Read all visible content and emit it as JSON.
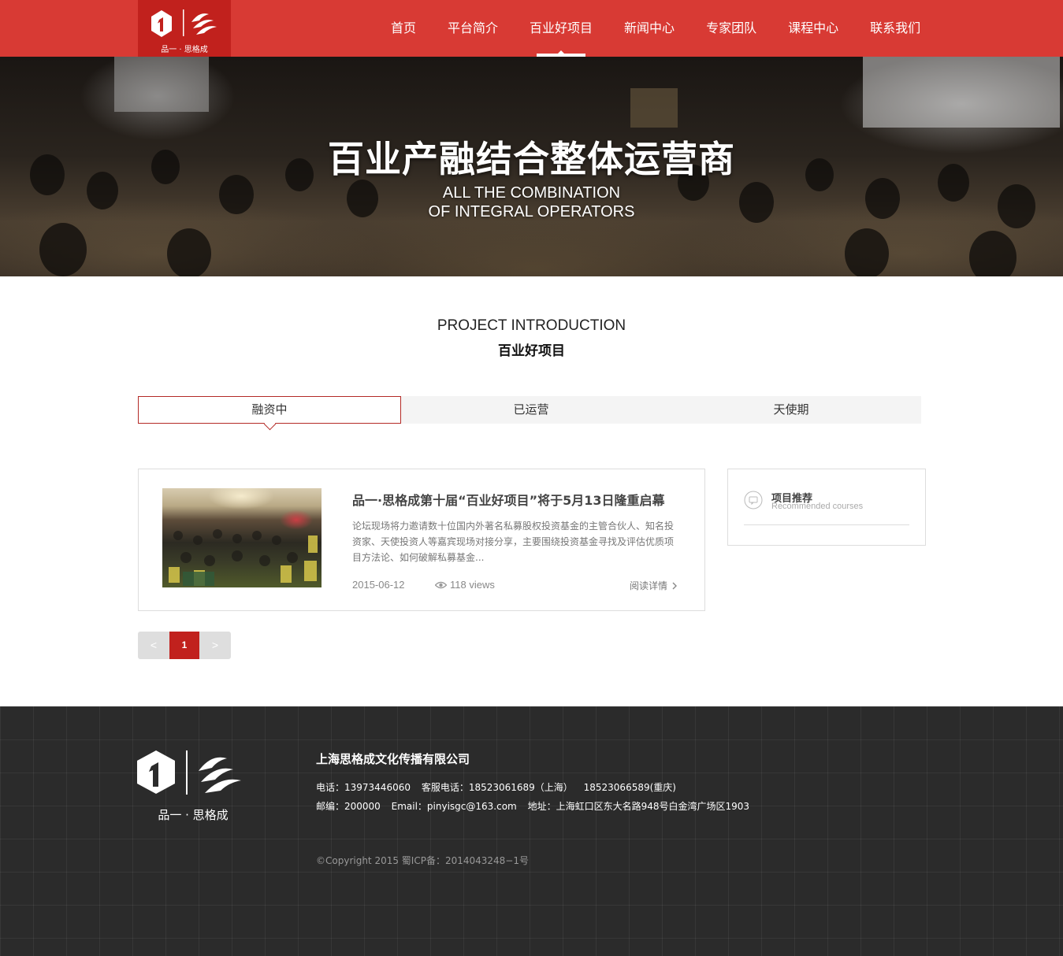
{
  "header": {
    "logo_text": "品一 · 思格成",
    "nav": [
      "首页",
      "平台简介",
      "百业好项目",
      "新闻中心",
      "专家团队",
      "课程中心",
      "联系我们"
    ],
    "active_index": 2,
    "brand_color": "#d83a34"
  },
  "banner": {
    "title": "百业产融结合整体运营商",
    "subtitle_line1": "ALL THE COMBINATION",
    "subtitle_line2": "OF INTEGRAL OPERATORS"
  },
  "section": {
    "title_en": "PROJECT INTRODUCTION",
    "title_cn": "百业好项目"
  },
  "tabs": [
    {
      "label": "融资中",
      "active": true
    },
    {
      "label": "已运营",
      "active": false
    },
    {
      "label": "天使期",
      "active": false
    }
  ],
  "article": {
    "title": "品一·思格成第十届“百业好项目”将于5月13日隆重启幕",
    "description": "论坛现场将力邀请数十位国内外著名私募股权投资基金的主管合伙人、知名投资家、天使投资人等嘉宾现场对接分享，主要围绕投资基金寻找及评估优质项目方法论、如何破解私募基金...",
    "date": "2015-06-12",
    "views": "118 views",
    "more_label": "阅读详情",
    "icons": [
      "eye-icon",
      "chevron-right-icon"
    ]
  },
  "sidebar": {
    "title": "项目推荐",
    "subtitle": "Recommended courses",
    "icon": "chat-bubble-icon"
  },
  "pagination": {
    "prev": "<",
    "current": "1",
    "next": ">"
  },
  "footer": {
    "logo_text": "品一 · 思格成",
    "company": "上海思格成文化传播有限公司",
    "phone": "电话：13973446060",
    "service_phone": "客服电话：18523061689（上海）",
    "service_phone2": "18523066589(重庆)",
    "postcode": "邮编：200000",
    "email": "Email：pinyisgc@163.com",
    "address": "地址：上海虹口区东大名路948号白金湾广场区1903",
    "copyright": "©Copyright 2015 蜀ICP备：2014043248−1号"
  }
}
